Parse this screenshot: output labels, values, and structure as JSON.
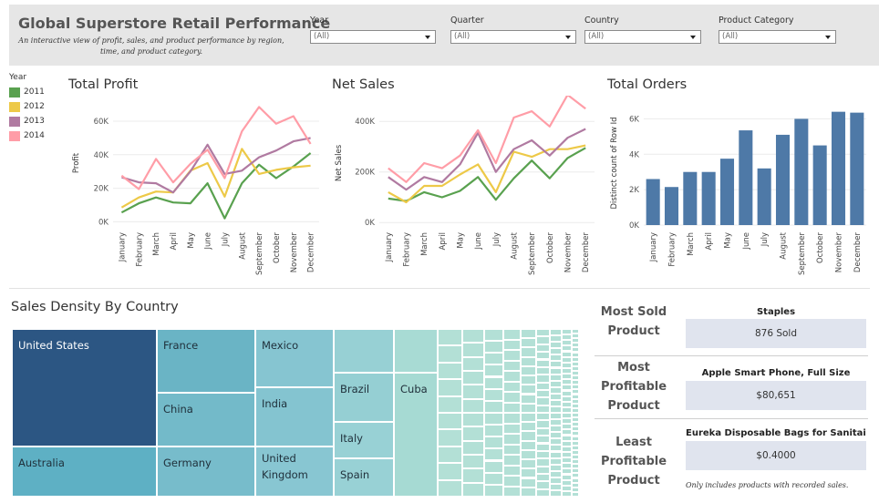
{
  "header": {
    "title": "Global Superstore Retail Performance",
    "subtitle": "An interactive view of profit, sales, and product performance by region, time, and product category."
  },
  "filters": [
    {
      "label": "Year",
      "value": "(All)"
    },
    {
      "label": "Quarter",
      "value": "(All)"
    },
    {
      "label": "Country",
      "value": "(All)"
    },
    {
      "label": "Product Category",
      "value": "(All)"
    }
  ],
  "legend": {
    "title": "Year",
    "items": [
      {
        "label": "2011",
        "color": "#59a14f"
      },
      {
        "label": "2012",
        "color": "#edc948"
      },
      {
        "label": "2013",
        "color": "#b07aa1"
      },
      {
        "label": "2014",
        "color": "#ff9da7"
      }
    ]
  },
  "months": [
    "January",
    "February",
    "March",
    "April",
    "May",
    "June",
    "July",
    "August",
    "September",
    "October",
    "November",
    "December"
  ],
  "chart_data": [
    {
      "type": "line",
      "title": "Total Profit",
      "ylabel": "Profit",
      "ylim": [
        -2000,
        72000
      ],
      "yticks": [
        0,
        20000,
        40000,
        60000
      ],
      "ytick_labels": [
        "0K",
        "20K",
        "40K",
        "60K"
      ],
      "series": [
        {
          "name": "2011",
          "color": "#59a14f",
          "values": [
            5500,
            11000,
            14500,
            11500,
            11000,
            23000,
            2000,
            23000,
            34000,
            26000,
            33000,
            41000
          ]
        },
        {
          "name": "2012",
          "color": "#edc948",
          "values": [
            8500,
            14500,
            18000,
            17500,
            30500,
            35000,
            15000,
            43500,
            28500,
            31000,
            32500,
            33500
          ]
        },
        {
          "name": "2013",
          "color": "#b07aa1",
          "values": [
            26500,
            23500,
            23000,
            17500,
            30000,
            46000,
            28500,
            30500,
            38500,
            42500,
            48000,
            50000
          ]
        },
        {
          "name": "2014",
          "color": "#ff9da7",
          "values": [
            27500,
            19500,
            37500,
            23500,
            34500,
            43000,
            26000,
            54000,
            68500,
            58500,
            63000,
            46500
          ]
        }
      ]
    },
    {
      "type": "line",
      "title": "Net Sales",
      "ylabel": "Net Sales",
      "ylim": [
        -10000,
        480000
      ],
      "yticks": [
        0,
        200000,
        400000
      ],
      "ytick_labels": [
        "0K",
        "200K",
        "400K"
      ],
      "series": [
        {
          "name": "2011",
          "color": "#59a14f",
          "values": [
            95000,
            85000,
            120000,
            100000,
            125000,
            180000,
            90000,
            175000,
            245000,
            175000,
            255000,
            295000
          ]
        },
        {
          "name": "2012",
          "color": "#edc948",
          "values": [
            120000,
            80000,
            145000,
            145000,
            190000,
            230000,
            120000,
            280000,
            260000,
            290000,
            290000,
            305000
          ]
        },
        {
          "name": "2013",
          "color": "#b07aa1",
          "values": [
            180000,
            130000,
            180000,
            160000,
            230000,
            355000,
            200000,
            290000,
            325000,
            265000,
            335000,
            370000
          ]
        },
        {
          "name": "2014",
          "color": "#ff9da7",
          "values": [
            215000,
            160000,
            235000,
            215000,
            265000,
            365000,
            235000,
            415000,
            440000,
            380000,
            505000,
            450000
          ]
        }
      ]
    },
    {
      "type": "bar",
      "title": "Total Orders",
      "ylabel": "Distinct count of Row Id",
      "ylim": [
        0,
        7000
      ],
      "yticks": [
        0,
        2000,
        4000,
        6000
      ],
      "ytick_labels": [
        "0K",
        "2K",
        "4K",
        "6K"
      ],
      "categories": [
        "January",
        "February",
        "March",
        "April",
        "May",
        "June",
        "July",
        "August",
        "September",
        "October",
        "November",
        "December"
      ],
      "color": "#4e79a7",
      "values": [
        2600,
        2150,
        3000,
        3000,
        3750,
        5350,
        3200,
        5100,
        6000,
        4500,
        6400,
        6350
      ]
    },
    {
      "type": "heatmap",
      "title": "Sales Density By Country",
      "labeled_cells": [
        "United States",
        "Australia",
        "France",
        "China",
        "Germany",
        "Mexico",
        "India",
        "United Kingdom",
        "Brazil",
        "Italy",
        "Spain",
        "Cuba"
      ]
    }
  ],
  "kpis": [
    {
      "label": "Most Sold Product",
      "name": "Staples",
      "value": "876 Sold"
    },
    {
      "label": "Most Profitable Product",
      "name": "Apple Smart Phone, Full Size",
      "value": "$80,651"
    },
    {
      "label": "Least Profitable Product",
      "name": "Eureka Disposable Bags for Sanitaire ..",
      "value": "$0.4000"
    }
  ],
  "kpi_note": "Only includes products with recorded sales."
}
